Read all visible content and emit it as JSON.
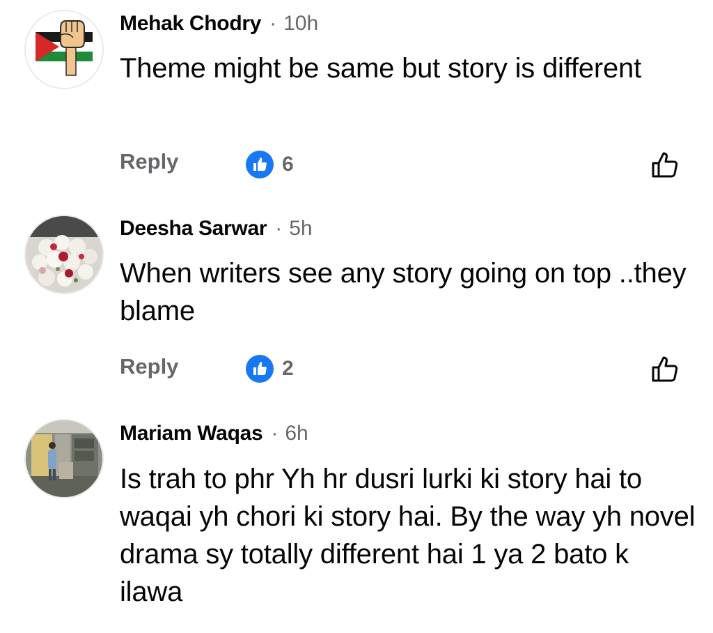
{
  "comments": [
    {
      "author": "Mehak Chodry",
      "separator": "·",
      "time": "10h",
      "text": "Theme might be same but story is different",
      "reply_label": "Reply",
      "like_count": "6"
    },
    {
      "author": "Deesha Sarwar",
      "separator": "·",
      "time": "5h",
      "text": "When writers see any story going on top ..they blame",
      "reply_label": "Reply",
      "like_count": "2"
    },
    {
      "author": "Mariam Waqas",
      "separator": "·",
      "time": "6h",
      "text": "Is trah to phr Yh hr dusri lurki ki story hai to waqai yh chori ki story hai. By the way yh novel drama sy totally different hai 1 ya 2 bato k ilawa"
    }
  ],
  "icons": {
    "reaction_badge": "like-badge-icon",
    "like_action": "thumbs-up-outline-icon"
  },
  "colors": {
    "accent": "#1877f2",
    "secondary_text": "#65676b",
    "primary_text": "#050505"
  }
}
